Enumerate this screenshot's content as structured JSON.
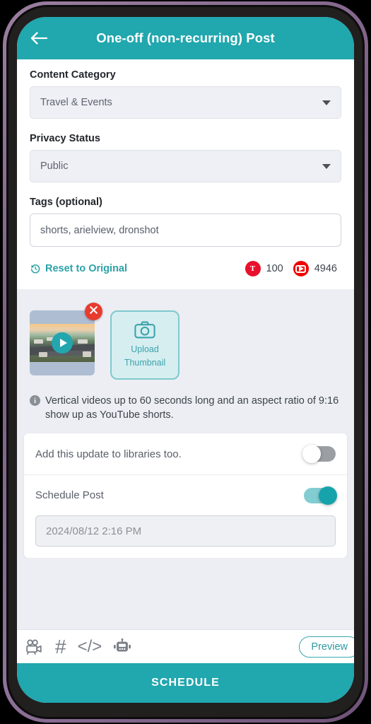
{
  "header": {
    "title": "One-off (non-recurring) Post",
    "back_icon": "arrow-left-icon",
    "accent_color": "#21a7ae"
  },
  "form": {
    "content_category": {
      "label": "Content Category",
      "value": "Travel & Events"
    },
    "privacy_status": {
      "label": "Privacy Status",
      "value": "Public"
    },
    "tags": {
      "label": "Tags (optional)",
      "value": "shorts, arielview, dronshot"
    },
    "reset": {
      "label": "Reset to Original",
      "icon": "restore-history-icon",
      "color": "#2ba3a8"
    },
    "counters": [
      {
        "icon": "title-badge-icon",
        "letter": "T",
        "value": "100",
        "color": "#e8112d"
      },
      {
        "icon": "youtube-badge-icon",
        "value": "4946",
        "color": "#f00000"
      }
    ]
  },
  "media": {
    "thumbnail": {
      "name": "video-thumbnail",
      "play_icon": "play-icon",
      "delete_icon": "close-icon"
    },
    "upload": {
      "icon": "camera-icon",
      "line1": "Upload",
      "line2": "Thumbnail"
    },
    "info_note": {
      "icon": "info-icon",
      "text": "Vertical videos up to 60 seconds long and an aspect ratio of 9:16 show up as YouTube shorts."
    }
  },
  "options": {
    "add_to_libraries": {
      "label": "Add this update to libraries too.",
      "enabled": false
    },
    "schedule_post": {
      "label": "Schedule Post",
      "enabled": true
    },
    "schedule_datetime": "2024/08/12 2:16 PM"
  },
  "toolbar": {
    "icons": [
      {
        "name": "video-camera-icon"
      },
      {
        "name": "hashtag-icon",
        "glyph": "#"
      },
      {
        "name": "code-icon",
        "glyph": "</>"
      },
      {
        "name": "robot-icon"
      }
    ],
    "preview_label": "Preview"
  },
  "action": {
    "schedule_label": "SCHEDULE"
  }
}
